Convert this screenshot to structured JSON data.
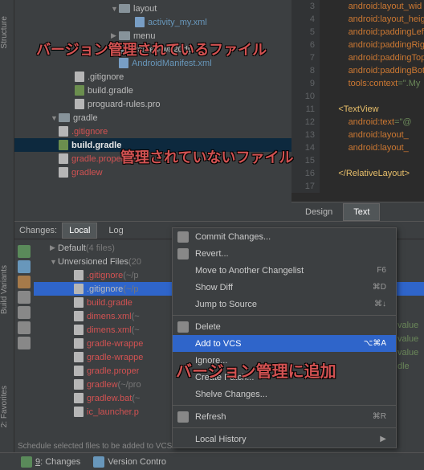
{
  "tree": {
    "items": [
      {
        "indent": 120,
        "arrow": "▼",
        "icon": "folder",
        "label": "layout",
        "cls": ""
      },
      {
        "indent": 140,
        "arrow": "",
        "icon": "file-xml",
        "label": "activity_my.xml",
        "cls": "blue"
      },
      {
        "indent": 120,
        "arrow": "▶",
        "icon": "folder",
        "label": "menu",
        "cls": ""
      },
      {
        "indent": 120,
        "arrow": "▼",
        "icon": "folder",
        "label": "values-w820dp",
        "cls": ""
      },
      {
        "indent": 120,
        "arrow": "",
        "icon": "file-xml",
        "label": "AndroidManifest.xml",
        "cls": "blue"
      },
      {
        "indent": 65,
        "arrow": "",
        "icon": "file-txt",
        "label": ".gitignore",
        "cls": ""
      },
      {
        "indent": 65,
        "arrow": "",
        "icon": "file-gradle",
        "label": "build.gradle",
        "cls": ""
      },
      {
        "indent": 65,
        "arrow": "",
        "icon": "file-txt",
        "label": "proguard-rules.pro",
        "cls": ""
      },
      {
        "indent": 45,
        "arrow": "▼",
        "icon": "folder",
        "label": "gradle",
        "cls": ""
      },
      {
        "indent": 45,
        "arrow": "",
        "icon": "file-txt",
        "label": ".gitignore",
        "cls": "red"
      },
      {
        "indent": 45,
        "arrow": "",
        "icon": "file-gradle",
        "label": "build.gradle",
        "cls": "white",
        "sel": true
      },
      {
        "indent": 45,
        "arrow": "",
        "icon": "file-txt",
        "label": "gradle.properties",
        "cls": "red"
      },
      {
        "indent": 45,
        "arrow": "",
        "icon": "file-txt",
        "label": "gradlew",
        "cls": "red"
      }
    ]
  },
  "editor": {
    "lines": [
      "3",
      "4",
      "5",
      "6",
      "7",
      "8",
      "9",
      "10",
      "11",
      "12",
      "13",
      "14",
      "15",
      "16",
      "17"
    ],
    "code": [
      {
        "a": "android:",
        "k": "layout_wid"
      },
      {
        "a": "android:",
        "k": "layout_heig"
      },
      {
        "a": "android:",
        "k": "paddingLeft"
      },
      {
        "a": "android:",
        "k": "paddingRig"
      },
      {
        "a": "android:",
        "k": "paddingTop"
      },
      {
        "a": "android:",
        "k": "paddingBot"
      },
      {
        "a": "tools:",
        "k": "context",
        "v": "=\".My"
      },
      {
        "blank": true
      },
      {
        "tag": "<TextView"
      },
      {
        "a": "android:",
        "k": "text",
        "v": "=\"@"
      },
      {
        "a": "android:",
        "k": "layout_"
      },
      {
        "a": "android:",
        "k": "layout_"
      },
      {
        "blank": true
      },
      {
        "tag": "</RelativeLayout>"
      }
    ],
    "tabs": {
      "design": "Design",
      "text": "Text"
    }
  },
  "overlays": {
    "o1": "バージョン管理されているファイル",
    "o2": "管理されていないファイル",
    "o3": "バージョン管理に追加"
  },
  "changes": {
    "title": "Changes:",
    "tab_local": "Local",
    "tab_log": "Log",
    "default_label": "Default",
    "default_count": "(4 files)",
    "unversioned_label": "Unversioned Files",
    "unversioned_count": "(20",
    "files": [
      {
        "label": ".gitignore",
        "tail": " (~/p"
      },
      {
        "label": ".gitignore",
        "tail": " (~/p",
        "sel": true
      },
      {
        "label": "build.gradle",
        "tail": ""
      },
      {
        "label": "dimens.xml",
        "tail": " (~"
      },
      {
        "label": "dimens.xml",
        "tail": " (~"
      },
      {
        "label": "gradle-wrappe",
        "tail": ""
      },
      {
        "label": "gradle-wrappe",
        "tail": ""
      },
      {
        "label": "gradle.proper",
        "tail": ""
      },
      {
        "label": "gradlew",
        "tail": " (~/pro"
      },
      {
        "label": "gradlew.bat",
        "tail": " (~"
      },
      {
        "label": "ic_launcher.p",
        "tail": ""
      }
    ]
  },
  "menu": {
    "items": [
      {
        "label": "Commit Changes...",
        "short": "",
        "icon": "vcs"
      },
      {
        "label": "Revert...",
        "short": "",
        "icon": "revert"
      },
      {
        "label": "Move to Another Changelist",
        "short": "F6"
      },
      {
        "label": "Show Diff",
        "short": "⌘D"
      },
      {
        "label": "Jump to Source",
        "short": "⌘↓"
      },
      {
        "sep": true
      },
      {
        "label": "Delete",
        "short": "",
        "icon": "x"
      },
      {
        "label": "Add to VCS",
        "short": "⌥⌘A",
        "sel": true
      },
      {
        "label": "Ignore...",
        "short": ""
      },
      {
        "label": "Create Patch...",
        "short": ""
      },
      {
        "label": "Shelve Changes...",
        "short": ""
      },
      {
        "sep": true
      },
      {
        "label": "Refresh",
        "short": "⌘R",
        "icon": "refresh"
      },
      {
        "sep": true
      },
      {
        "label": "Local History",
        "short": "▶"
      }
    ]
  },
  "right_text": [
    "value",
    "value",
    "value",
    "dle"
  ],
  "bottom": {
    "changes_num": "9",
    "changes_label": ": Changes",
    "vc_label": "Version Contro"
  },
  "status": "Schedule selected files to be added to VCS"
}
